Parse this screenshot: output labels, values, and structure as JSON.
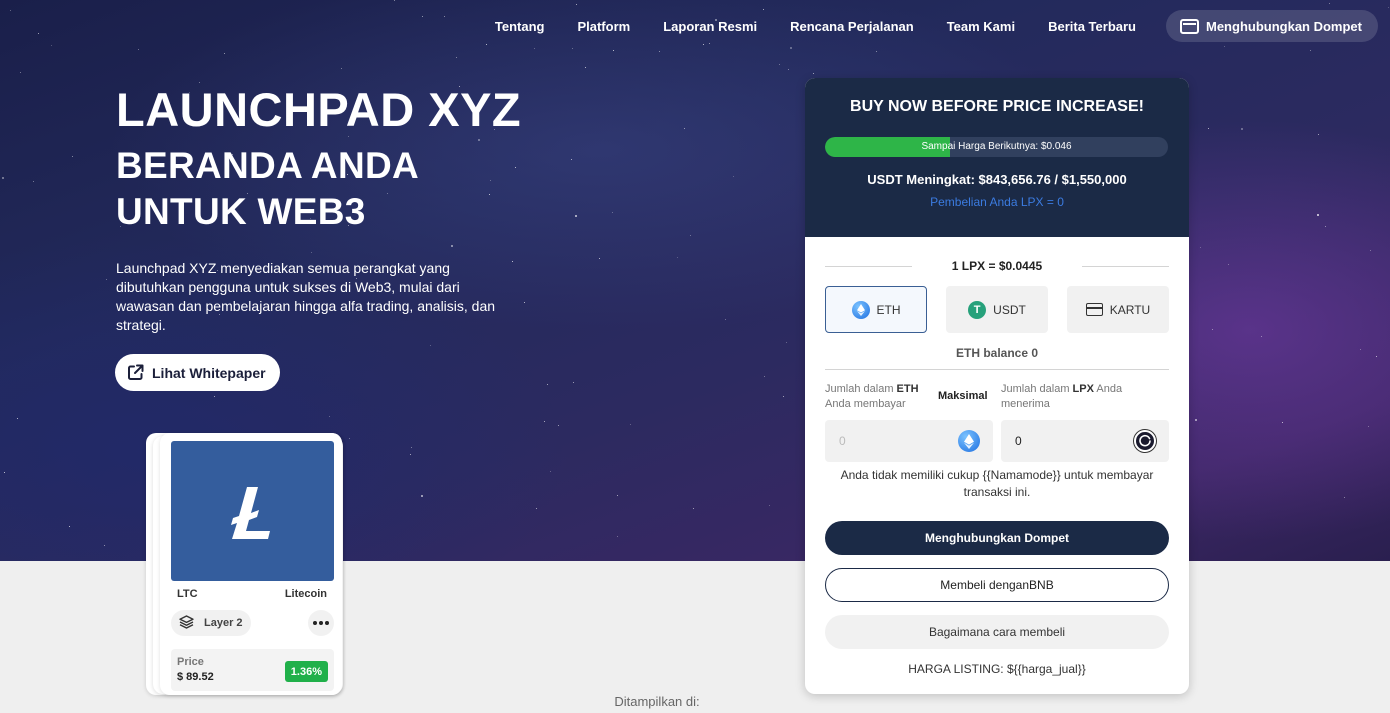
{
  "nav": {
    "links": [
      "Tentang",
      "Platform",
      "Laporan Resmi",
      "Rencana Perjalanan",
      "Team Kami",
      "Berita Terbaru"
    ],
    "wallet_button": "Menghubungkan Dompet"
  },
  "hero": {
    "title": "LAUNCHPAD XYZ",
    "subtitle": "BERANDA ANDA UNTUK WEB3",
    "description": "Launchpad XYZ menyediakan semua perangkat yang dibutuhkan pengguna untuk sukses di Web3, mulai dari wawasan dan pembelajaran hingga alfa trading, analisis, dan strategi.",
    "whitepaper_button": "Lihat Whitepaper"
  },
  "coin_card": {
    "symbol": "LTC",
    "name": "Litecoin",
    "category": "Layer 2",
    "price_label": "Price",
    "price": "$ 89.52",
    "change": "1.36%",
    "logo_color": "#345d9d",
    "change_color": "#20b04a"
  },
  "shown_on": "Ditampilkan di:",
  "widget": {
    "heading": "BUY NOW BEFORE PRICE INCREASE!",
    "progress_label": "Sampai Harga Berikutnya: $0.046",
    "progress_fraction": 0.365,
    "raised": "USDT Meningkat: $843,656.76 / $1,550,000",
    "purchased": "Pembelian Anda LPX = 0",
    "rate": "1 LPX = $0.0445",
    "methods": [
      {
        "label": "ETH",
        "icon": "eth-icon",
        "active": true
      },
      {
        "label": "USDT",
        "icon": "usdt-icon",
        "active": false
      },
      {
        "label": "KARTU",
        "icon": "card-icon",
        "active": false
      }
    ],
    "balance": "ETH balance 0",
    "pay_label": {
      "pre": "Jumlah dalam ",
      "token": "ETH",
      "post": " Anda membayar"
    },
    "max_label": "Maksimal",
    "receive_label": {
      "pre": "Jumlah dalam ",
      "token": "LPX",
      "post": " Anda menerima"
    },
    "pay_placeholder": "0",
    "receive_value": "0",
    "warning": "Anda tidak memiliki cukup {{Namamode}} untuk membayar transaksi ini.",
    "connect_button": "Menghubungkan Dompet",
    "bnb_button": "Membeli denganBNB",
    "how_button": "Bagaimana cara membeli",
    "listing": "HARGA LISTING: ${{harga_jual}}",
    "accent_color": "#1b2a46",
    "progress_color": "#2eb548"
  }
}
